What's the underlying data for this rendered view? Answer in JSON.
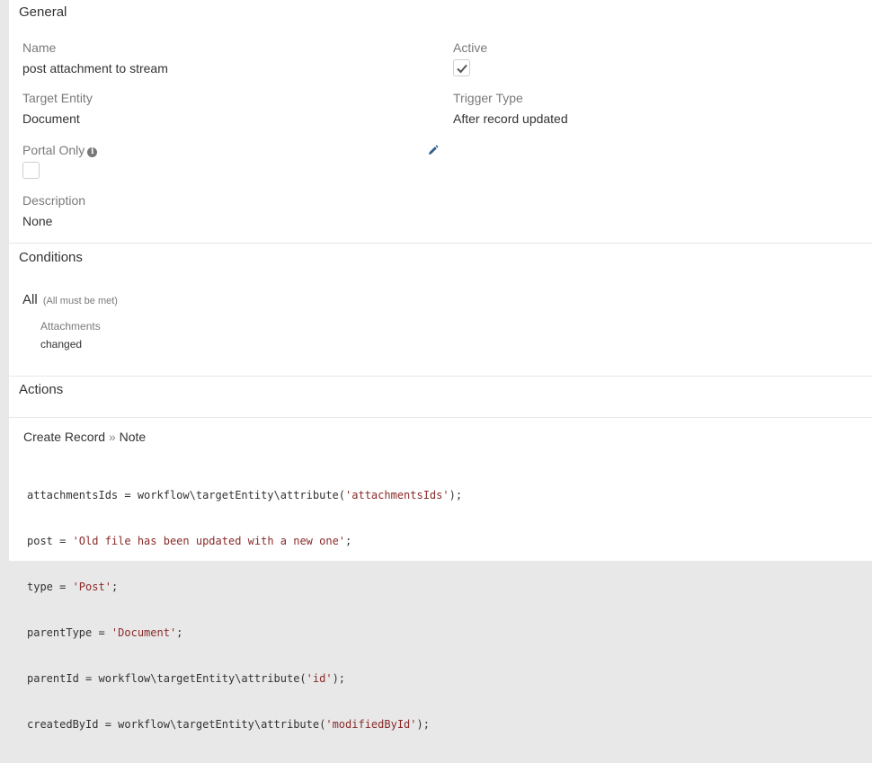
{
  "general": {
    "title": "General",
    "name_label": "Name",
    "name_value": "post attachment to stream",
    "active_label": "Active",
    "active_checked": true,
    "target_entity_label": "Target Entity",
    "target_entity_value": "Document",
    "trigger_type_label": "Trigger Type",
    "trigger_type_value": "After record updated",
    "portal_only_label": "Portal Only",
    "portal_only_checked": false,
    "description_label": "Description",
    "description_value": "None",
    "icons": [
      "info-icon",
      "pencil-icon",
      "checkmark-icon"
    ]
  },
  "conditions": {
    "title": "Conditions",
    "group_label": "All",
    "group_hint": "(All must be met)",
    "items": [
      {
        "field": "Attachments",
        "operator": "changed"
      }
    ]
  },
  "actions": {
    "title": "Actions",
    "action_type": "Create Record",
    "separator": "»",
    "entity": "Note",
    "code_lines": [
      {
        "pre": "attachmentsIds = workflow\\targetEntity\\attribute(",
        "str": "'attachmentsIds'",
        "post": ");"
      },
      {
        "pre": "post = ",
        "str": "'Old file has been updated with a new one'",
        "post": ";"
      },
      {
        "pre": "type = ",
        "str": "'Post'",
        "post": ";"
      },
      {
        "pre": "parentType = ",
        "str": "'Document'",
        "post": ";"
      },
      {
        "pre": "parentId = workflow\\targetEntity\\attribute(",
        "str": "'id'",
        "post": ");"
      },
      {
        "pre": "createdById = workflow\\targetEntity\\attribute(",
        "str": "'modifiedById'",
        "post": ");"
      }
    ]
  }
}
